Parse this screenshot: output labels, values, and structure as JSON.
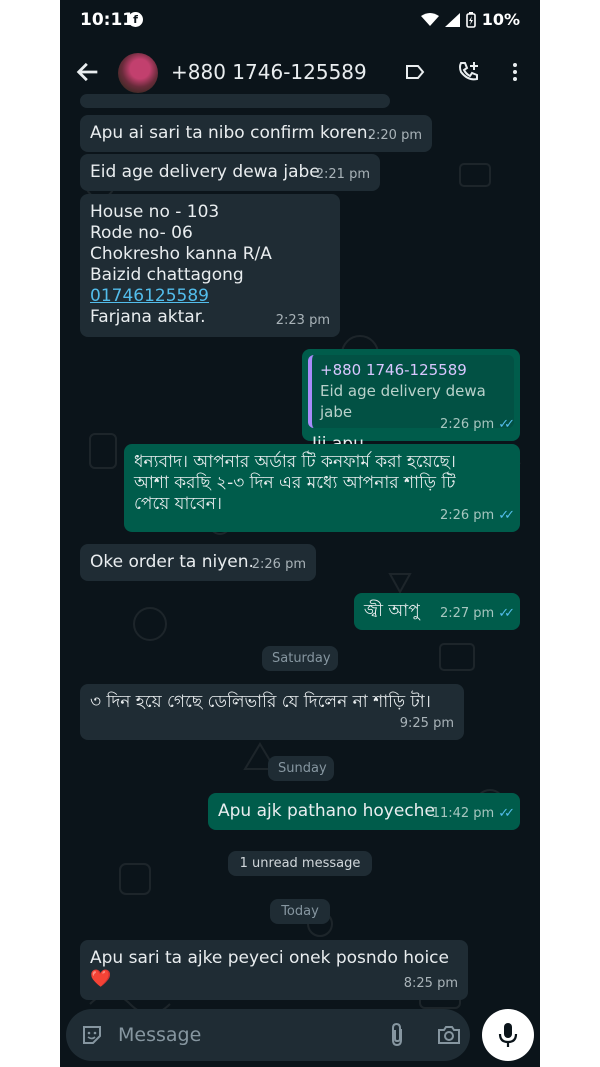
{
  "status_bar": {
    "time": "10:11",
    "battery": "10%"
  },
  "header": {
    "contact_name": "+880 1746-125589"
  },
  "messages": [
    {
      "text": "Apu ai sari ta nibo confirm koren.",
      "time": "2:20 pm"
    },
    {
      "text": "Eid age delivery dewa jabe",
      "time": "2:21 pm"
    },
    {
      "lines": [
        "House no - 103",
        "Rode no- 06",
        "Chokresho kanna R/A",
        "Baizid chattagong"
      ],
      "link": "01746125589",
      "last_line": "Farjana aktar.",
      "time": "2:23 pm"
    },
    {
      "quote_name": "+880 1746-125589",
      "quote_text": "Eid age delivery dewa jabe",
      "text": "Jii apu",
      "time": "2:26 pm"
    },
    {
      "text": "ধন্যবাদ। আপনার অর্ডার টি কনফার্ম করা হয়েছে। আশা করছি ২-৩ দিন এর মধ্যে আপনার শাড়ি টি পেয়ে যাবেন।",
      "time": "2:26 pm"
    },
    {
      "text": "Oke order ta niyen.",
      "time": "2:26 pm"
    },
    {
      "text": "জ্বী আপু",
      "time": "2:27 pm"
    },
    {
      "text": "৩ দিন হয়ে গেছে ডেলিভারি যে দিলেন না শাড়ি টা।",
      "time": "9:25 pm"
    },
    {
      "text": "Apu ajk pathano hoyeche",
      "time": "11:42 pm"
    },
    {
      "text": "Apu sari ta ajke peyeci onek posndo hoice ❤️",
      "time": "8:25 pm"
    }
  ],
  "dividers": {
    "saturday": "Saturday",
    "sunday": "Sunday",
    "unread": "1 unread message",
    "today": "Today"
  },
  "input": {
    "placeholder": "Message"
  },
  "colors": {
    "background": "#0b141a",
    "incoming": "#1f2c34",
    "outgoing": "#005c4b",
    "read_ticks": "#53bdeb"
  }
}
